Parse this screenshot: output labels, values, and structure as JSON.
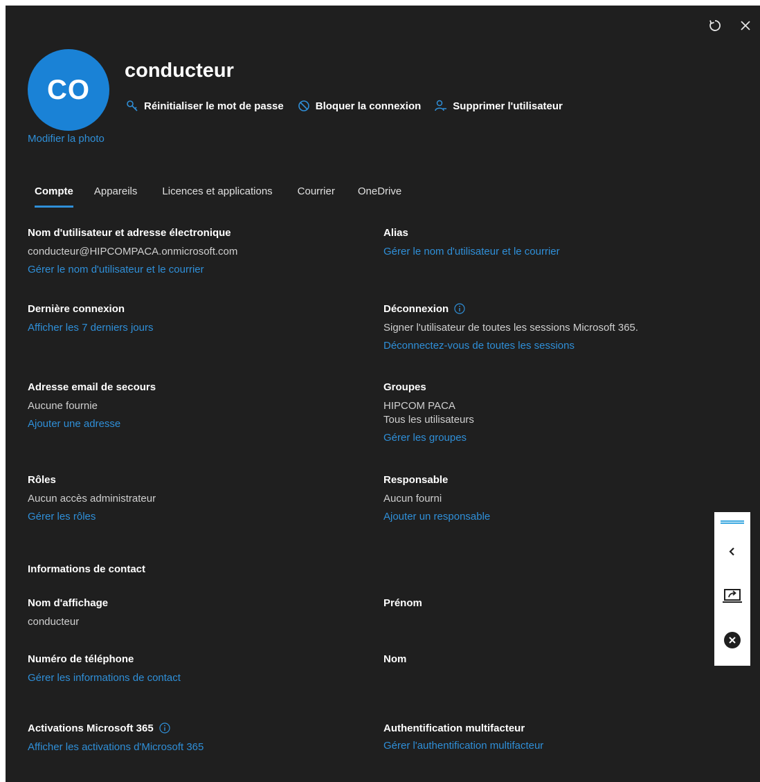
{
  "user": {
    "name": "conducteur",
    "initials": "CO",
    "modify_photo": "Modifier la photo"
  },
  "actions": [
    {
      "label": "Réinitialiser le mot de passe",
      "icon": "key-icon"
    },
    {
      "label": "Bloquer la connexion",
      "icon": "block-icon"
    },
    {
      "label": "Supprimer l'utilisateur",
      "icon": "remove-user-icon"
    }
  ],
  "tabs": [
    {
      "label": "Compte",
      "active": true
    },
    {
      "label": "Appareils"
    },
    {
      "label": "Licences et applications"
    },
    {
      "label": "Courrier"
    },
    {
      "label": "OneDrive"
    }
  ],
  "sections": {
    "username": {
      "label": "Nom d'utilisateur et adresse électronique",
      "value": "conducteur@HIPCOMPACA.onmicrosoft.com",
      "link": "Gérer le nom d'utilisateur et le courrier"
    },
    "alias": {
      "label": "Alias",
      "link": "Gérer le nom d'utilisateur et le courrier"
    },
    "last_login": {
      "label": "Dernière connexion",
      "link": "Afficher les 7 derniers jours"
    },
    "signout": {
      "label": "Déconnexion",
      "value": "Signer l'utilisateur de toutes les sessions Microsoft 365.",
      "link": "Déconnectez-vous de toutes les sessions"
    },
    "backup_email": {
      "label": "Adresse email de secours",
      "value": "Aucune fournie",
      "link": "Ajouter une adresse"
    },
    "groups": {
      "label": "Groupes",
      "values": [
        "HIPCOM PACA",
        "Tous les utilisateurs"
      ],
      "link": "Gérer les groupes"
    },
    "roles": {
      "label": "Rôles",
      "value": "Aucun accès administrateur",
      "link": "Gérer les rôles"
    },
    "manager": {
      "label": "Responsable",
      "value": "Aucun fourni",
      "link": "Ajouter un responsable"
    },
    "contact_info": {
      "label": "Informations de contact"
    },
    "display_name": {
      "label": "Nom d'affichage",
      "value": "conducteur"
    },
    "first_name": {
      "label": "Prénom"
    },
    "phone": {
      "label": "Numéro de téléphone",
      "link": "Gérer les informations de contact"
    },
    "last_name": {
      "label": "Nom"
    },
    "activations": {
      "label": "Activations Microsoft 365",
      "link": "Afficher les activations d'Microsoft 365"
    },
    "mfa": {
      "label": "Authentification multifacteur",
      "link": "Gérer l'authentification multifacteur"
    }
  },
  "colors": {
    "panel_bg": "#1f1f1f",
    "accent": "#2f8fd8",
    "avatar": "#1a82d6"
  }
}
